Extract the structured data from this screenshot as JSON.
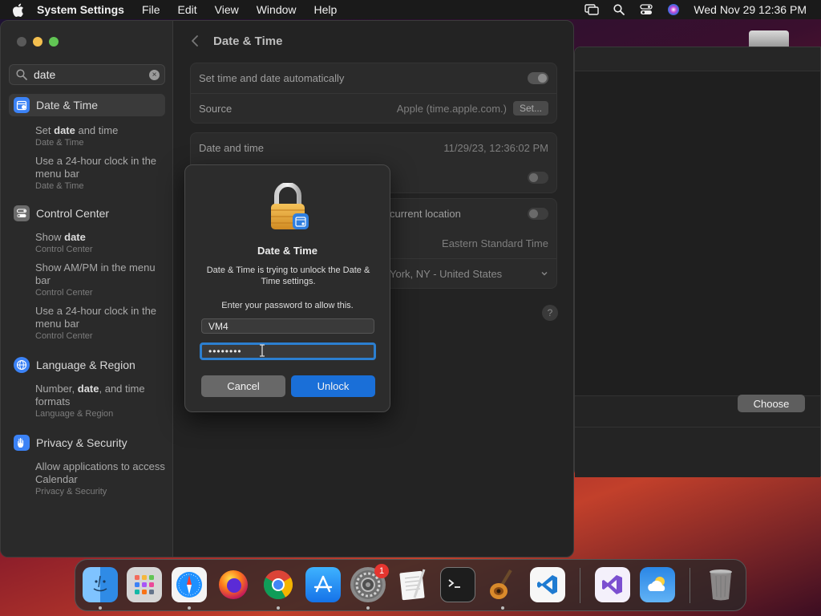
{
  "menubar": {
    "app_name": "System Settings",
    "items": [
      "File",
      "Edit",
      "View",
      "Window",
      "Help"
    ],
    "clock": "Wed Nov 29  12:36 PM"
  },
  "sidebar": {
    "search_value": "date",
    "sections": [
      {
        "label": "Date & Time",
        "icon": "calendar-icon",
        "color": "#3b82f6",
        "results": [
          {
            "pre": "Set ",
            "bold": "date",
            "post": " and time",
            "sub": "Date & Time"
          },
          {
            "pre": "Use a 24-hour clock in the menu bar",
            "bold": "",
            "post": "",
            "sub": "Date & Time"
          }
        ]
      },
      {
        "label": "Control Center",
        "icon": "control-center-icon",
        "color": "#6b6b6b",
        "results": [
          {
            "pre": "Show ",
            "bold": "date",
            "post": "",
            "sub": "Control Center"
          },
          {
            "pre": "Show AM/PM in the menu bar",
            "bold": "",
            "post": "",
            "sub": "Control Center"
          },
          {
            "pre": "Use a 24-hour clock in the menu bar",
            "bold": "",
            "post": "",
            "sub": "Control Center"
          }
        ]
      },
      {
        "label": "Language & Region",
        "icon": "globe-icon",
        "color": "#3b82f6",
        "results": [
          {
            "pre": "Number, ",
            "bold": "date",
            "post": ", and time formats",
            "sub": "Language & Region"
          }
        ]
      },
      {
        "label": "Privacy & Security",
        "icon": "hand-icon",
        "color": "#3b82f6",
        "results": [
          {
            "pre": "Allow applications to access Calendar",
            "bold": "",
            "post": "",
            "sub": "Privacy & Security"
          }
        ]
      }
    ]
  },
  "content": {
    "title": "Date & Time",
    "auto_label": "Set time and date automatically",
    "source_label": "Source",
    "source_value": "Apple (time.apple.com.)",
    "set_button": "Set...",
    "datetime_label": "Date and time",
    "datetime_value": "11/29/23, 12:36:02 PM",
    "location_label": "current location",
    "timezone_value": "Eastern Standard Time",
    "city_value": "York, NY - United States",
    "help": "?"
  },
  "dialog": {
    "title": "Date & Time",
    "message": "Date & Time is trying to unlock the Date & Time settings.",
    "prompt": "Enter your password to allow this.",
    "username": "VM4",
    "password_mask": "••••••••",
    "cancel": "Cancel",
    "unlock": "Unlock"
  },
  "bgwindow": {
    "choose": "Choose"
  },
  "dock": {
    "apps": [
      {
        "name": "Finder",
        "icon": "finder-icon",
        "color": "#2f8be6",
        "running": true
      },
      {
        "name": "Launchpad",
        "icon": "launchpad-icon",
        "color": "#c9c9c9",
        "running": false
      },
      {
        "name": "Safari",
        "icon": "safari-icon",
        "color": "#1e90ff",
        "running": true
      },
      {
        "name": "Firefox",
        "icon": "firefox-icon",
        "color": "#e8501b",
        "running": false
      },
      {
        "name": "Chrome",
        "icon": "chrome-icon",
        "color": "#e8e8e8",
        "running": true
      },
      {
        "name": "App Store",
        "icon": "app-store-icon",
        "color": "#1c8ef9",
        "running": false
      },
      {
        "name": "System Settings",
        "icon": "settings-icon",
        "color": "#8a8a8a",
        "running": true,
        "badge": "1"
      },
      {
        "name": "TextEdit",
        "icon": "textedit-icon",
        "color": "#f1f1f1",
        "running": false
      },
      {
        "name": "Terminal",
        "icon": "terminal-icon",
        "color": "#1d1d1d",
        "running": false
      },
      {
        "name": "GarageBand",
        "icon": "garageband-icon",
        "color": "#7a4a1e",
        "running": true
      },
      {
        "name": "VS Code",
        "icon": "vscode-icon",
        "color": "#1f7bd1",
        "running": false
      },
      {
        "name": "Visual Studio",
        "icon": "visual-studio-icon",
        "color": "#f4f0fb",
        "running": false
      },
      {
        "name": "Weather",
        "icon": "weather-icon",
        "color": "#3a8ee6",
        "running": false
      },
      {
        "name": "Trash",
        "icon": "trash-icon",
        "color": "#9a9a9a",
        "running": false
      }
    ]
  }
}
